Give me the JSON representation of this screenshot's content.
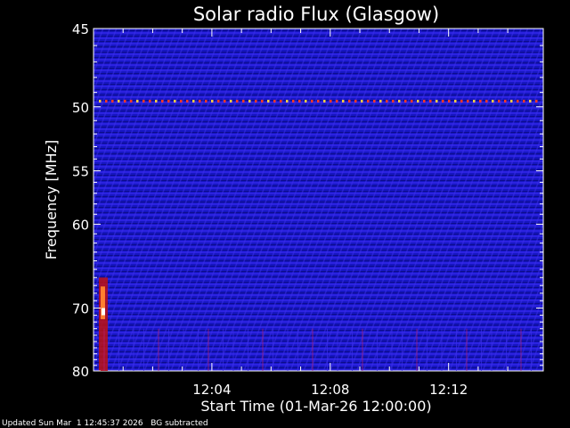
{
  "chart_data": {
    "type": "heatmap",
    "title": "Solar radio Flux (Glasgow)",
    "xlabel": "Start Time (01-Mar-26 12:00:00)",
    "ylabel": "Frequency [MHz]",
    "x_range_minutes": [
      0,
      15.2
    ],
    "y_range_mhz": [
      45,
      80
    ],
    "y_ticks": [
      {
        "value": 45,
        "label": "45"
      },
      {
        "value": 50,
        "label": "50"
      },
      {
        "value": 55,
        "label": "55"
      },
      {
        "value": 60,
        "label": "60"
      },
      {
        "value": 70,
        "label": "70"
      },
      {
        "value": 80,
        "label": "80"
      }
    ],
    "x_ticks": [
      {
        "value": 4,
        "label": "12:04"
      },
      {
        "value": 8,
        "label": "12:08"
      },
      {
        "value": 12,
        "label": "12:12"
      }
    ],
    "features": [
      {
        "type": "persistent_interference_line",
        "frequency_mhz": 49.6
      },
      {
        "type": "burst",
        "time_minutes": 0.3,
        "frequency_range_mhz": [
          66,
          80
        ]
      }
    ],
    "colors": {
      "background": "#000000",
      "low": "#1a14c8",
      "mid": "#ff2020",
      "high": "#ffffff"
    }
  },
  "footer": {
    "updated": "Updated Sun Mar  1 12:45:37 2026",
    "note": "BG subtracted"
  }
}
